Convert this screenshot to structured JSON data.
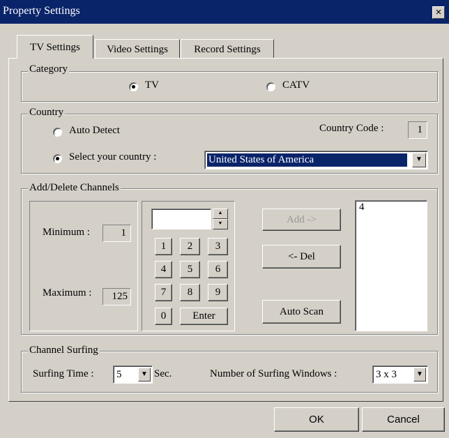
{
  "window": {
    "title": "Property Settings",
    "close_label": "×"
  },
  "tabs": [
    {
      "label": "TV Settings",
      "active": true
    },
    {
      "label": "Video Settings",
      "active": false
    },
    {
      "label": "Record Settings",
      "active": false
    }
  ],
  "category": {
    "legend": "Category",
    "options": [
      {
        "label": "TV",
        "selected": true
      },
      {
        "label": "CATV",
        "selected": false
      }
    ]
  },
  "country": {
    "legend": "Country",
    "auto_detect_label": "Auto Detect",
    "select_label": "Select your country :",
    "code_label": "Country Code :",
    "code_value": "1",
    "selected_country": "United States of America",
    "mode": "select"
  },
  "channels": {
    "legend": "Add/Delete Channels",
    "min_label": "Minimum :",
    "min_value": "1",
    "max_label": "Maximum :",
    "max_value": "125",
    "entry_value": "",
    "keys": [
      "1",
      "2",
      "3",
      "4",
      "5",
      "6",
      "7",
      "8",
      "9",
      "0"
    ],
    "enter_label": "Enter",
    "add_label": "Add ->",
    "del_label": "<- Del",
    "autoscan_label": "Auto Scan",
    "list": [
      "4"
    ]
  },
  "surfing": {
    "legend": "Channel Surfing",
    "time_label": "Surfing Time :",
    "time_value": "5",
    "sec_label": "Sec.",
    "windows_label": "Number of Surfing Windows :",
    "windows_value": "3 x 3"
  },
  "footer": {
    "ok_label": "OK",
    "cancel_label": "Cancel"
  },
  "colors": {
    "titlebar": "#0a246a",
    "face": "#d4d0c8",
    "selection": "#0a246a"
  }
}
